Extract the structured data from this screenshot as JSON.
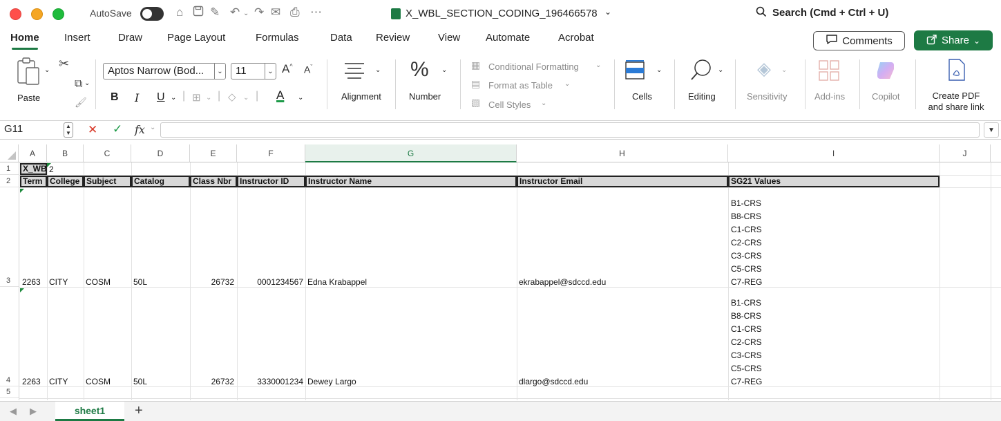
{
  "titlebar": {
    "autosave_label": "AutoSave",
    "filename": "X_WBL_SECTION_CODING_196466578",
    "search": "Search (Cmd + Ctrl + U)"
  },
  "tabs": [
    "Home",
    "Insert",
    "Draw",
    "Page Layout",
    "Formulas",
    "Data",
    "Review",
    "View",
    "Automate",
    "Acrobat"
  ],
  "buttons": {
    "comments": "Comments",
    "share": "Share"
  },
  "ribbon": {
    "paste": "Paste",
    "font_name": "Aptos Narrow (Bod...",
    "font_size": "11",
    "bold": "B",
    "italic": "I",
    "underline": "U",
    "alignment": "Alignment",
    "number": "Number",
    "conditional_formatting": "Conditional Formatting",
    "format_as_table": "Format as Table",
    "cell_styles": "Cell Styles",
    "cells": "Cells",
    "editing": "Editing",
    "sensitivity": "Sensitivity",
    "addins": "Add-ins",
    "copilot": "Copilot",
    "create_pdf_1": "Create PDF",
    "create_pdf_2": "and share link"
  },
  "formula_bar": {
    "name_box": "G11",
    "fx": "fx",
    "value": ""
  },
  "columns": [
    "A",
    "B",
    "C",
    "D",
    "E",
    "F",
    "G",
    "H",
    "I",
    "J"
  ],
  "rows": [
    "1",
    "2",
    "3",
    "4",
    "5"
  ],
  "sheet": {
    "a1": "X_WB",
    "b1": "2",
    "headers": [
      "Term",
      "College",
      "Subject",
      "Catalog",
      "Class Nbr",
      "Instructor ID",
      "Instructor Name",
      "Instructor Email",
      "SG21 Values"
    ],
    "records": [
      {
        "term": "2263",
        "college": "CITY",
        "subject": "COSM",
        "catalog": "50L",
        "class_nbr": "26732",
        "instructor_id": "0001234567",
        "instructor_name": "Edna Krabappel",
        "email": "ekrabappel@sdccd.edu",
        "sg21": [
          "B1-CRS",
          "B8-CRS",
          "C1-CRS",
          "C2-CRS",
          "C3-CRS",
          "C5-CRS",
          "C7-REG"
        ]
      },
      {
        "term": "2263",
        "college": "CITY",
        "subject": "COSM",
        "catalog": "50L",
        "class_nbr": "26732",
        "instructor_id": "3330001234",
        "instructor_name": "Dewey Largo",
        "email": "dlargo@sdccd.edu",
        "sg21": [
          "B1-CRS",
          "B8-CRS",
          "C1-CRS",
          "C2-CRS",
          "C3-CRS",
          "C5-CRS",
          "C7-REG"
        ]
      }
    ]
  },
  "sheet_tabs": {
    "active": "sheet1",
    "add": "+"
  },
  "colors": {
    "accent": "#1d7a44",
    "header_fill": "#d8d8d8"
  }
}
